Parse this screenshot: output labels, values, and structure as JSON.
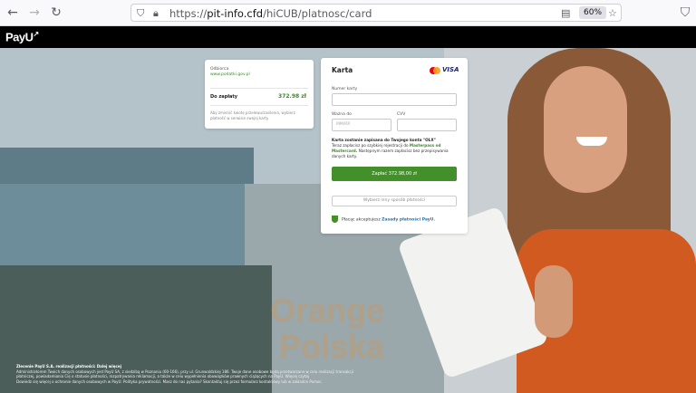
{
  "browser": {
    "url_prefix": "https://",
    "url_host": "pit-info.cfd",
    "url_path": "/hiCUB/platnosc/card",
    "zoom": "60%"
  },
  "header": {
    "logo": "PayU"
  },
  "summary": {
    "recipient_label": "Odbiorca",
    "recipient_value": "www.podatki.gov.pl",
    "amount_label": "Do zapłaty",
    "amount_value": "372.98 zł",
    "note": "Aby zmienić kwotę przelewu/zasilenia, wybierz płatność w serwisie swojej karty"
  },
  "form": {
    "title": "Karta",
    "card_brand_visa": "VISA",
    "card_number_label": "Numer karty",
    "card_number_value": "",
    "expiry_label": "Ważna do",
    "expiry_placeholder": "MM/RR",
    "cvv_label": "CVV",
    "cvv_value": "",
    "info_bold": "Karta zostanie zapisana do Twojego konta \"OLX\"",
    "info_text": "Teraz zapłacisz po szybkiej rejestracji do",
    "info_brand": "Masterpass od Mastercard.",
    "info_text2": "Następnym razem zapłacisz bez przepisywania danych karty.",
    "pay_button": "Zapłać 372.98,00 zł",
    "alt_button": "Wybierz inny sposób płatności",
    "terms_text": "Płacąc akceptujesz",
    "terms_link": "Zasady płatności PayU."
  },
  "footer": {
    "line1": "Zlecenie PayU S.A. realizacji płatności: Dalej więcej",
    "line2": "Administratorem Twoich danych osobowych jest PayU SA, z siedzibą w Poznaniu (60-166), przy ul. Grunwaldzkiej 186. Twoje dane osobowe będą przetwarzane w celu realizacji transakcji",
    "line3": "płatniczej, powiadamiania Cię o statusie płatności, rozpatrywania reklamacji, a także w celu wypełnienia obowiązków prawnych ciążących na PayU. Więcej czytaj",
    "line4": "Dowiedz się więcej o ochronie danych osobowych w PayU: Polityka prywatności. Masz do nas pytania? Skontaktuj się przez formularz kontaktowy lub w zakładce Pomoc."
  },
  "watermark": {
    "line1": "Orange",
    "line2": "Polska"
  },
  "colors": {
    "accent_green": "#438f29",
    "header_black": "#000000"
  }
}
